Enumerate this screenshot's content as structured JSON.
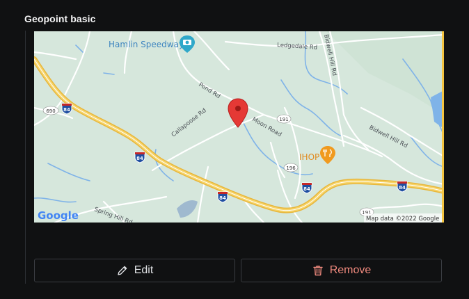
{
  "field": {
    "title": "Geopoint basic"
  },
  "map": {
    "labels": {
      "hamlin": "Hamlin Speedway",
      "ledgedale": "Ledgedale Rd",
      "bidwell_hill_v": "Bidwell Hill Rd",
      "pond": "Pond Rd",
      "callapoose": "Callapoose Rd",
      "moon": "Moon Road",
      "bidwell_hill_r": "Bidwell Hill Rd",
      "ihop": "IHOP",
      "spring_hill": "Spring Hill Rd",
      "r690": "690",
      "r191": "191",
      "r196": "196",
      "r191b": "191",
      "i84": "84"
    },
    "logo": "Google",
    "attribution": "Map data ©2022 Google"
  },
  "actions": {
    "edit_label": "Edit",
    "remove_label": "Remove"
  },
  "colors": {
    "background": "#101112",
    "map_land": "#d6e7dc",
    "highway": "#f2c84b",
    "water": "#7fb3e8",
    "pin": "#e53935",
    "remove": "#f08a7e",
    "accent": "#f4c542"
  }
}
